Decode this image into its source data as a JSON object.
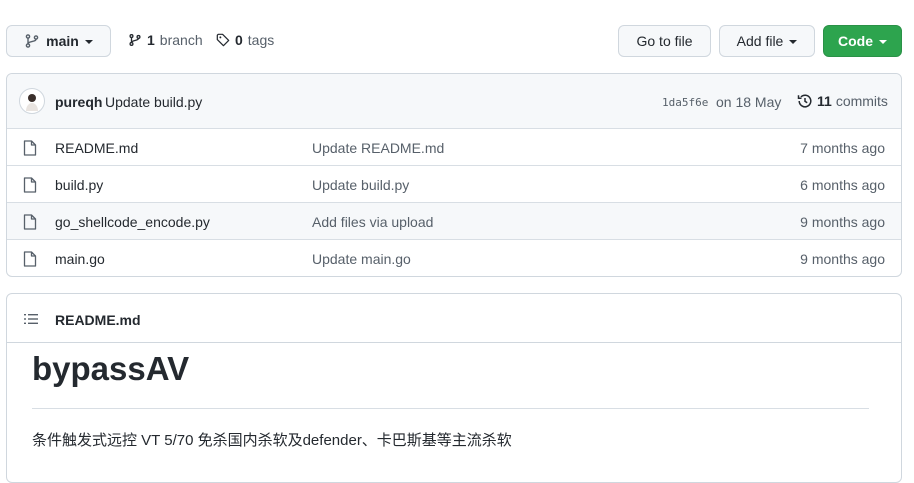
{
  "toolbar": {
    "branch_name": "main",
    "branch_count": "1",
    "branch_label": "branch",
    "tag_count": "0",
    "tag_label": "tags",
    "go_to_file": "Go to file",
    "add_file": "Add file",
    "code": "Code",
    "code_color": "#2da44e"
  },
  "commit": {
    "author": "pureqh",
    "message": "Update build.py",
    "hash": "1da5f6e",
    "date": "on 18 May",
    "count": "11",
    "count_label": "commits"
  },
  "files": [
    {
      "name": "README.md",
      "message": "Update README.md",
      "age": "7 months ago"
    },
    {
      "name": "build.py",
      "message": "Update build.py",
      "age": "6 months ago"
    },
    {
      "name": "go_shellcode_encode.py",
      "message": "Add files via upload",
      "age": "9 months ago"
    },
    {
      "name": "main.go",
      "message": "Update main.go",
      "age": "9 months ago"
    }
  ],
  "readme": {
    "header": "README.md",
    "title": "bypassAV",
    "description": "条件触发式远控 VT 5/70 免杀国内杀软及defender、卡巴斯基等主流杀软"
  }
}
